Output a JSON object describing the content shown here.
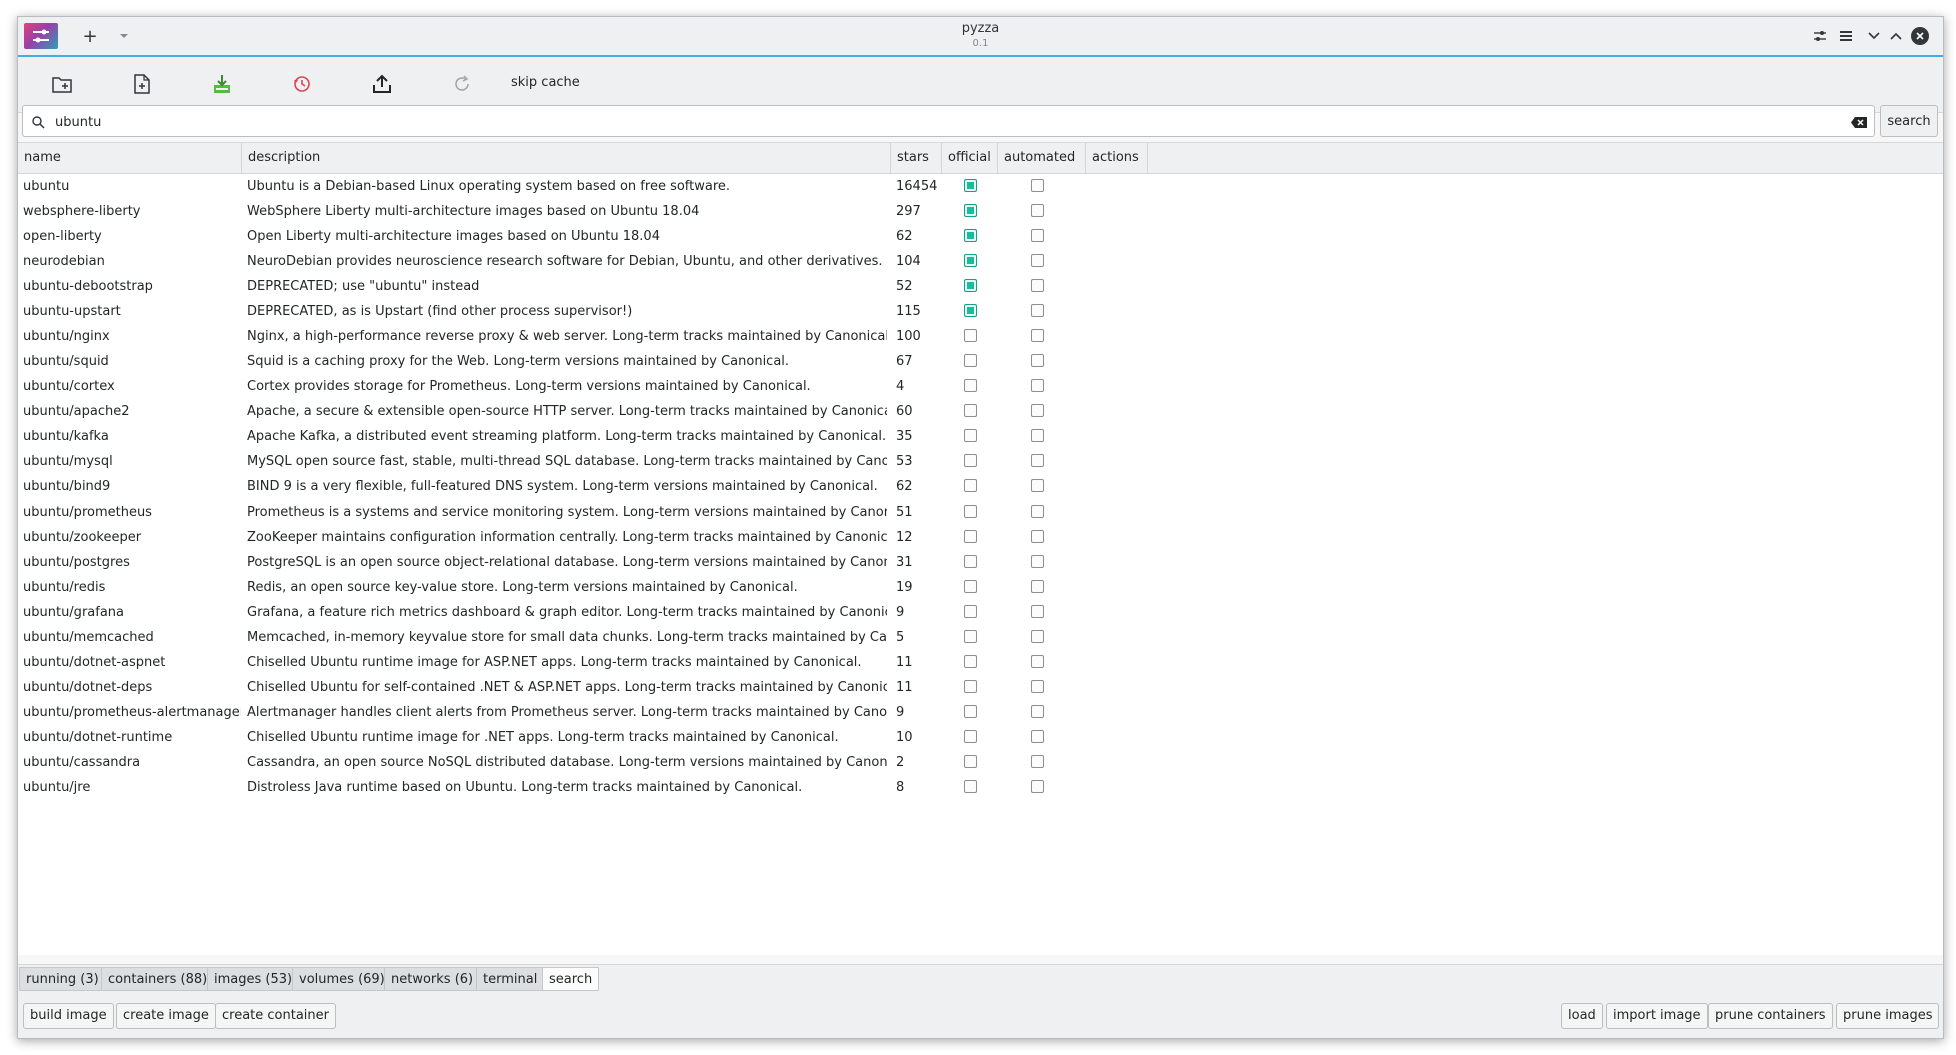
{
  "window": {
    "title": "pyzza",
    "version": "0.1"
  },
  "titlebar": {
    "new_tab_label": "+",
    "icons": [
      "app-icon",
      "new-tab-icon",
      "tab-dropdown-icon",
      "settings-icon",
      "menu-icon",
      "minimize-icon",
      "maximize-icon",
      "close-icon"
    ]
  },
  "toolbar": {
    "skip_cache_label": "skip cache",
    "icons": [
      "open-folder-icon",
      "new-file-icon",
      "pull-icon",
      "history-icon",
      "upload-icon",
      "refresh-icon"
    ]
  },
  "search": {
    "value": "ubuntu",
    "placeholder": "",
    "button_label": "search"
  },
  "table": {
    "columns": [
      "name",
      "description",
      "stars",
      "official",
      "automated",
      "actions"
    ],
    "rows": [
      {
        "name": "ubuntu",
        "description": "Ubuntu is a Debian-based Linux operating system based on free software.",
        "stars": "16454",
        "official": true,
        "automated": false
      },
      {
        "name": "websphere-liberty",
        "description": "WebSphere Liberty multi-architecture images based on Ubuntu 18.04",
        "stars": "297",
        "official": true,
        "automated": false
      },
      {
        "name": "open-liberty",
        "description": "Open Liberty multi-architecture images based on Ubuntu 18.04",
        "stars": "62",
        "official": true,
        "automated": false
      },
      {
        "name": "neurodebian",
        "description": "NeuroDebian provides neuroscience research software for Debian, Ubuntu, and other derivatives.",
        "stars": "104",
        "official": true,
        "automated": false
      },
      {
        "name": "ubuntu-debootstrap",
        "description": "DEPRECATED; use \"ubuntu\" instead",
        "stars": "52",
        "official": true,
        "automated": false
      },
      {
        "name": "ubuntu-upstart",
        "description": "DEPRECATED, as is Upstart (find other process supervisor!)",
        "stars": "115",
        "official": true,
        "automated": false
      },
      {
        "name": "ubuntu/nginx",
        "description": "Nginx, a high-performance reverse proxy & web server. Long-term tracks maintained by Canonical.",
        "stars": "100",
        "official": false,
        "automated": false
      },
      {
        "name": "ubuntu/squid",
        "description": "Squid is a caching proxy for the Web. Long-term versions maintained by Canonical.",
        "stars": "67",
        "official": false,
        "automated": false
      },
      {
        "name": "ubuntu/cortex",
        "description": "Cortex provides storage for Prometheus. Long-term versions maintained by Canonical.",
        "stars": "4",
        "official": false,
        "automated": false
      },
      {
        "name": "ubuntu/apache2",
        "description": "Apache, a secure & extensible open-source HTTP server. Long-term tracks maintained by Canonical.",
        "stars": "60",
        "official": false,
        "automated": false
      },
      {
        "name": "ubuntu/kafka",
        "description": "Apache Kafka, a distributed event streaming platform. Long-term tracks maintained by Canonical.",
        "stars": "35",
        "official": false,
        "automated": false
      },
      {
        "name": "ubuntu/mysql",
        "description": "MySQL open source fast, stable, multi-thread SQL database. Long-term tracks maintained by Canonical.",
        "stars": "53",
        "official": false,
        "automated": false
      },
      {
        "name": "ubuntu/bind9",
        "description": "BIND 9 is a very flexible, full-featured DNS system. Long-term versions maintained by Canonical.",
        "stars": "62",
        "official": false,
        "automated": false
      },
      {
        "name": "ubuntu/prometheus",
        "description": "Prometheus is a systems and service monitoring system. Long-term versions maintained by Canonical.",
        "stars": "51",
        "official": false,
        "automated": false
      },
      {
        "name": "ubuntu/zookeeper",
        "description": "ZooKeeper maintains configuration information centrally. Long-term tracks maintained by Canonical.",
        "stars": "12",
        "official": false,
        "automated": false
      },
      {
        "name": "ubuntu/postgres",
        "description": "PostgreSQL is an open source object-relational database. Long-term versions maintained by Canonical.",
        "stars": "31",
        "official": false,
        "automated": false
      },
      {
        "name": "ubuntu/redis",
        "description": "Redis, an open source key-value store. Long-term versions maintained by Canonical.",
        "stars": "19",
        "official": false,
        "automated": false
      },
      {
        "name": "ubuntu/grafana",
        "description": "Grafana, a feature rich metrics dashboard & graph editor. Long-term tracks maintained by Canonical.",
        "stars": "9",
        "official": false,
        "automated": false
      },
      {
        "name": "ubuntu/memcached",
        "description": "Memcached, in-memory keyvalue store for small data chunks. Long-term tracks maintained by Canonical.",
        "stars": "5",
        "official": false,
        "automated": false
      },
      {
        "name": "ubuntu/dotnet-aspnet",
        "description": "Chiselled Ubuntu runtime image for ASP.NET apps. Long-term tracks maintained by Canonical.",
        "stars": "11",
        "official": false,
        "automated": false
      },
      {
        "name": "ubuntu/dotnet-deps",
        "description": "Chiselled Ubuntu for self-contained .NET & ASP.NET apps. Long-term tracks maintained by Canonical.",
        "stars": "11",
        "official": false,
        "automated": false
      },
      {
        "name": "ubuntu/prometheus-alertmanager",
        "description": "Alertmanager handles client alerts from Prometheus server. Long-term tracks maintained by Canonical.",
        "stars": "9",
        "official": false,
        "automated": false
      },
      {
        "name": "ubuntu/dotnet-runtime",
        "description": "Chiselled Ubuntu runtime image for .NET apps. Long-term tracks maintained by Canonical.",
        "stars": "10",
        "official": false,
        "automated": false
      },
      {
        "name": "ubuntu/cassandra",
        "description": "Cassandra, an open source NoSQL distributed database. Long-term versions maintained by Canonical.",
        "stars": "2",
        "official": false,
        "automated": false
      },
      {
        "name": "ubuntu/jre",
        "description": "Distroless Java runtime based on Ubuntu. Long-term tracks maintained by Canonical.",
        "stars": "8",
        "official": false,
        "automated": false
      }
    ]
  },
  "tabs": [
    {
      "label": "running (3)",
      "active": false
    },
    {
      "label": "containers (88)",
      "active": false
    },
    {
      "label": "images (53)",
      "active": false
    },
    {
      "label": "volumes (69)",
      "active": false
    },
    {
      "label": "networks (6)",
      "active": false
    },
    {
      "label": "terminal",
      "active": false
    },
    {
      "label": "search",
      "active": true
    }
  ],
  "bottom_left": [
    "build image",
    "create image",
    "create container"
  ],
  "bottom_right": [
    "load",
    "import image",
    "prune containers",
    "prune images"
  ],
  "colors": {
    "accent": "#3daee9",
    "checked": "#1abc9c"
  }
}
